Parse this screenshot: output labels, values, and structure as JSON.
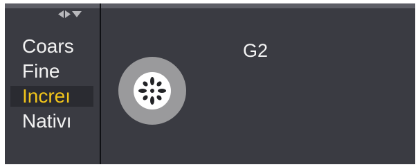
{
  "panel_controls": {
    "icons": [
      "left-arrow-icon",
      "right-arrow-icon",
      "down-arrow-icon"
    ],
    "colors": {
      "arrow": "#b8b8bc"
    }
  },
  "step_options": {
    "items": [
      {
        "label": "Coars",
        "selected": false
      },
      {
        "label": "Fine",
        "selected": false
      },
      {
        "label": "Increı",
        "selected": true
      },
      {
        "label": "Nativı",
        "selected": false
      }
    ],
    "colors": {
      "text": "#f2f2f2",
      "selected_text": "#f2c51b",
      "selected_bg": "#2a2b31"
    }
  },
  "main": {
    "title": "G2",
    "stepper_icon": "pan-tilt-dial-icon",
    "colors": {
      "background": "#3a3b42",
      "dial": "#9a9a9c",
      "dial_marks": "#ffffff"
    }
  }
}
